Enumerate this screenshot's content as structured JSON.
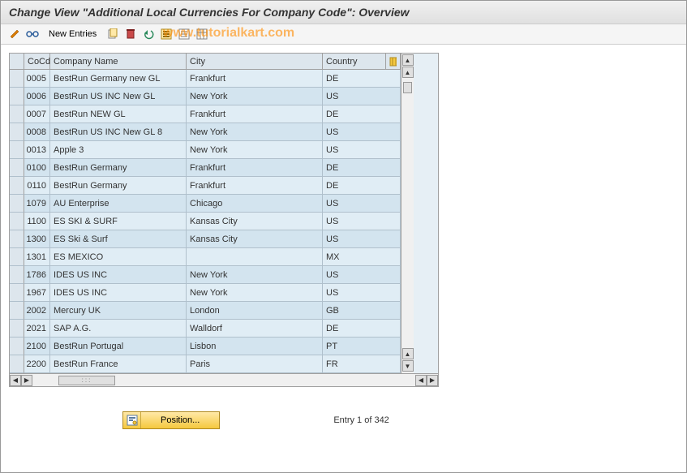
{
  "title": "Change View \"Additional Local Currencies For Company Code\": Overview",
  "watermark": "www.tutorialkart.com",
  "toolbar": {
    "new_entries_label": "New Entries"
  },
  "columns": {
    "cocd": "CoCd",
    "company_name": "Company Name",
    "city": "City",
    "country": "Country"
  },
  "rows": [
    {
      "cocd": "0005",
      "name": "BestRun Germany new GL",
      "city": "Frankfurt",
      "country": "DE"
    },
    {
      "cocd": "0006",
      "name": "BestRun US INC New GL",
      "city": "New York",
      "country": "US"
    },
    {
      "cocd": "0007",
      "name": "BestRun NEW GL",
      "city": "Frankfurt",
      "country": "DE"
    },
    {
      "cocd": "0008",
      "name": "BestRun US INC New GL 8",
      "city": "New York",
      "country": "US"
    },
    {
      "cocd": "0013",
      "name": "Apple 3",
      "city": "New York",
      "country": "US"
    },
    {
      "cocd": "0100",
      "name": "BestRun Germany",
      "city": "Frankfurt",
      "country": "DE"
    },
    {
      "cocd": "0110",
      "name": "BestRun Germany",
      "city": "Frankfurt",
      "country": "DE"
    },
    {
      "cocd": "1079",
      "name": "AU Enterprise",
      "city": "Chicago",
      "country": "US"
    },
    {
      "cocd": "1100",
      "name": "ES SKI & SURF",
      "city": "Kansas City",
      "country": "US"
    },
    {
      "cocd": "1300",
      "name": "ES Ski & Surf",
      "city": "Kansas City",
      "country": "US"
    },
    {
      "cocd": "1301",
      "name": "ES MEXICO",
      "city": "",
      "country": "MX"
    },
    {
      "cocd": "1786",
      "name": "IDES US INC",
      "city": "New York",
      "country": "US"
    },
    {
      "cocd": "1967",
      "name": "IDES US INC",
      "city": "New York",
      "country": "US"
    },
    {
      "cocd": "2002",
      "name": "Mercury UK",
      "city": "London",
      "country": "GB"
    },
    {
      "cocd": "2021",
      "name": "SAP A.G.",
      "city": "Walldorf",
      "country": "DE"
    },
    {
      "cocd": "2100",
      "name": "BestRun Portugal",
      "city": "Lisbon",
      "country": "PT"
    },
    {
      "cocd": "2200",
      "name": "BestRun France",
      "city": "Paris",
      "country": "FR"
    }
  ],
  "footer": {
    "position_label": "Position...",
    "entry_text": "Entry 1 of 342"
  }
}
